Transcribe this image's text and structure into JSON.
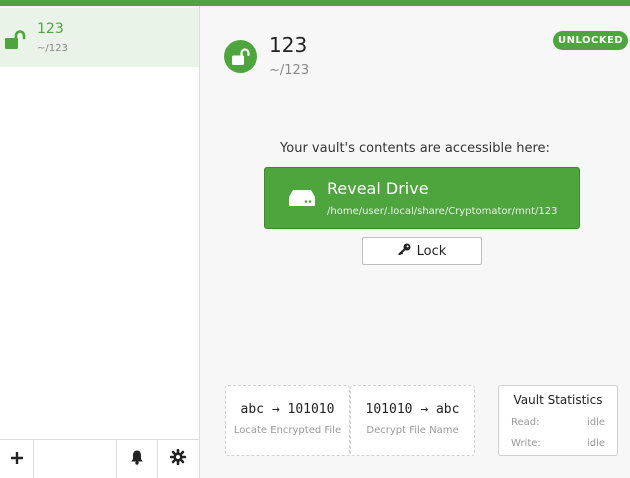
{
  "colors": {
    "accent": "#4ea53e",
    "sidebar_selected": "#eaf3e7"
  },
  "sidebar": {
    "vaults": [
      {
        "name": "123",
        "path": "~/123",
        "icon": "unlocked-padlock-icon"
      }
    ],
    "footer": {
      "add_icon": "plus-icon",
      "notify_icon": "bell-icon",
      "settings_icon": "gear-icon"
    }
  },
  "main": {
    "vault_name": "123",
    "vault_path": "~/123",
    "status_badge": "UNLOCKED",
    "accessible_text": "Your vault's contents are accessible here:",
    "reveal": {
      "label": "Reveal Drive",
      "mount_path": "/home/user/.local/share/Cryptomator/mnt/123",
      "icon": "drive-icon"
    },
    "lock_button": {
      "label": "Lock",
      "icon": "key-icon"
    },
    "tools": [
      {
        "code": "abc → 101010",
        "label": "Locate Encrypted File"
      },
      {
        "code": "101010 → abc",
        "label": "Decrypt File Name"
      }
    ],
    "stats": {
      "title": "Vault Statistics",
      "read_label": "Read:",
      "read_value": "idle",
      "write_label": "Write:",
      "write_value": "idle"
    }
  }
}
